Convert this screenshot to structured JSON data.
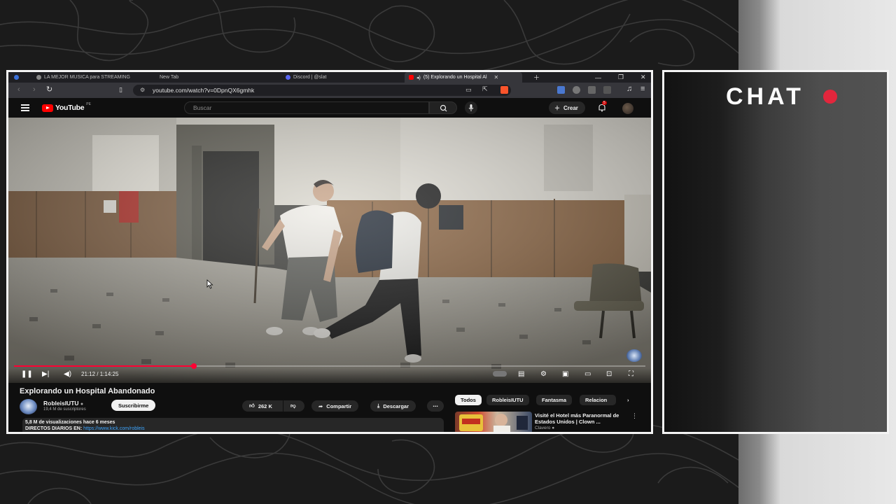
{
  "browser": {
    "tabs": [
      {
        "label": "LA MEJOR MUSICA para STREAMING",
        "favicon": "music-icon"
      },
      {
        "label": "New Tab",
        "favicon": "none"
      },
      {
        "label": "Discord | @slat",
        "favicon": "discord-icon"
      },
      {
        "label": "(5) Explorando un Hospital Al",
        "favicon": "youtube-icon",
        "active": true
      }
    ],
    "url": "youtube.com/watch?v=0DpnQX6gmhk"
  },
  "youtube": {
    "logo_text": "YouTube",
    "logo_region": "PE",
    "search_placeholder": "Buscar",
    "create_label": "Crear",
    "notification_count": "5"
  },
  "player": {
    "current_time": "21:12",
    "duration": "1:14:25",
    "progress": 0.285,
    "state": "playing"
  },
  "video": {
    "title": "Explorando un Hospital Abandonado",
    "channel": "RobleisIUTU",
    "subscribers": "19,4 M de suscriptores",
    "subscribe_label": "Suscribirme",
    "likes": "262 K",
    "share_label": "Compartir",
    "download_label": "Descargar",
    "views_line": "5,8 M de visualizaciones  hace 6 meses",
    "desc_line": "DIRECTOS DIARIOS EN: ",
    "desc_link": "https://www.kick.com/robleis"
  },
  "sidebar": {
    "chips": [
      "Todos",
      "RobleisIUTU",
      "Fantasma",
      "Relacion"
    ],
    "recommended": {
      "title": "Visité el Hotel más Paranormal de Estados Unidos | Clown ...",
      "channel": "Clavero"
    }
  },
  "chat": {
    "title": "CHAT",
    "dot_color": "#e3263c"
  },
  "colors": {
    "accent": "#ff0033",
    "youtube_red": "#ff0000",
    "link": "#3ea6ff"
  }
}
